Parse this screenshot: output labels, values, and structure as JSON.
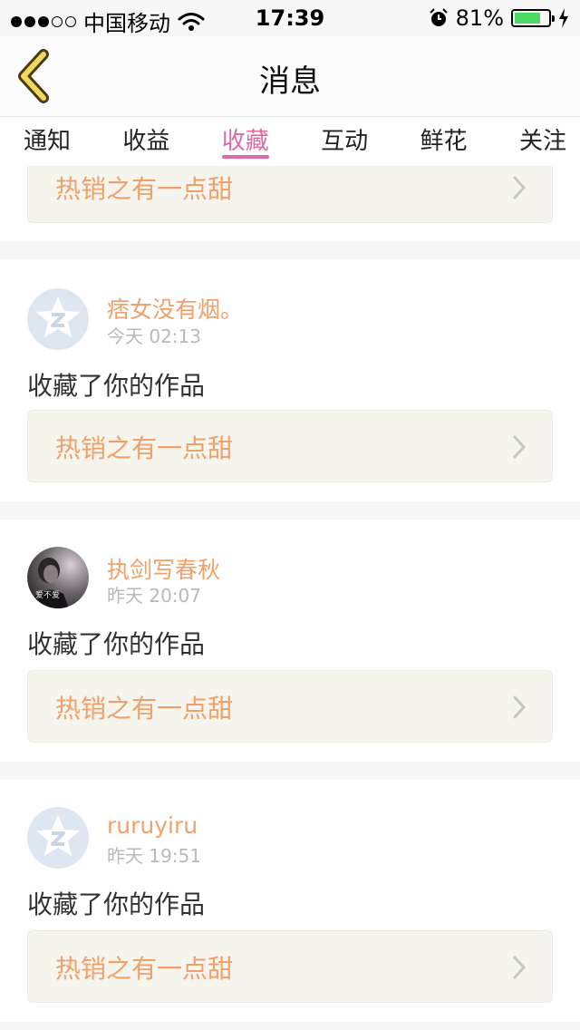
{
  "status_bar": {
    "carrier": "中国移动",
    "time": "17:39",
    "battery_percent": "81%",
    "battery_level": 0.81,
    "signal_full": 3,
    "signal_empty": 2,
    "icons": [
      "wifi-icon",
      "alarm-icon",
      "battery-icon",
      "charging-bolt-icon"
    ]
  },
  "nav": {
    "title": "消息",
    "back_icon": "chevron-left-icon",
    "accent_color": "#f2d95c"
  },
  "tabs": [
    {
      "label": "通知",
      "active": false
    },
    {
      "label": "收益",
      "active": false
    },
    {
      "label": "收藏",
      "active": true
    },
    {
      "label": "互动",
      "active": false
    },
    {
      "label": "鲜花",
      "active": false
    },
    {
      "label": "关注",
      "active": false
    }
  ],
  "colors": {
    "active_tab": "#e06aa6",
    "username": "#f0a16b",
    "work_title": "#f0a16b",
    "work_box_bg": "#f5f4ed"
  },
  "partial_top_work": {
    "title": "热销之有一点甜"
  },
  "messages": [
    {
      "username": "痞女没有烟。",
      "time": "今天 02:13",
      "action": "收藏了你的作品",
      "work_title": "热销之有一点甜",
      "avatar": "qzone-star-default-avatar"
    },
    {
      "username": "执剑写春秋",
      "time": "昨天 20:07",
      "action": "收藏了你的作品",
      "work_title": "热销之有一点甜",
      "avatar": "photo-avatar",
      "avatar_caption": "爱不爱"
    },
    {
      "username": "ruruyiru",
      "time": "昨天 19:51",
      "action": "收藏了你的作品",
      "work_title": "热销之有一点甜",
      "avatar": "qzone-star-default-avatar"
    }
  ]
}
